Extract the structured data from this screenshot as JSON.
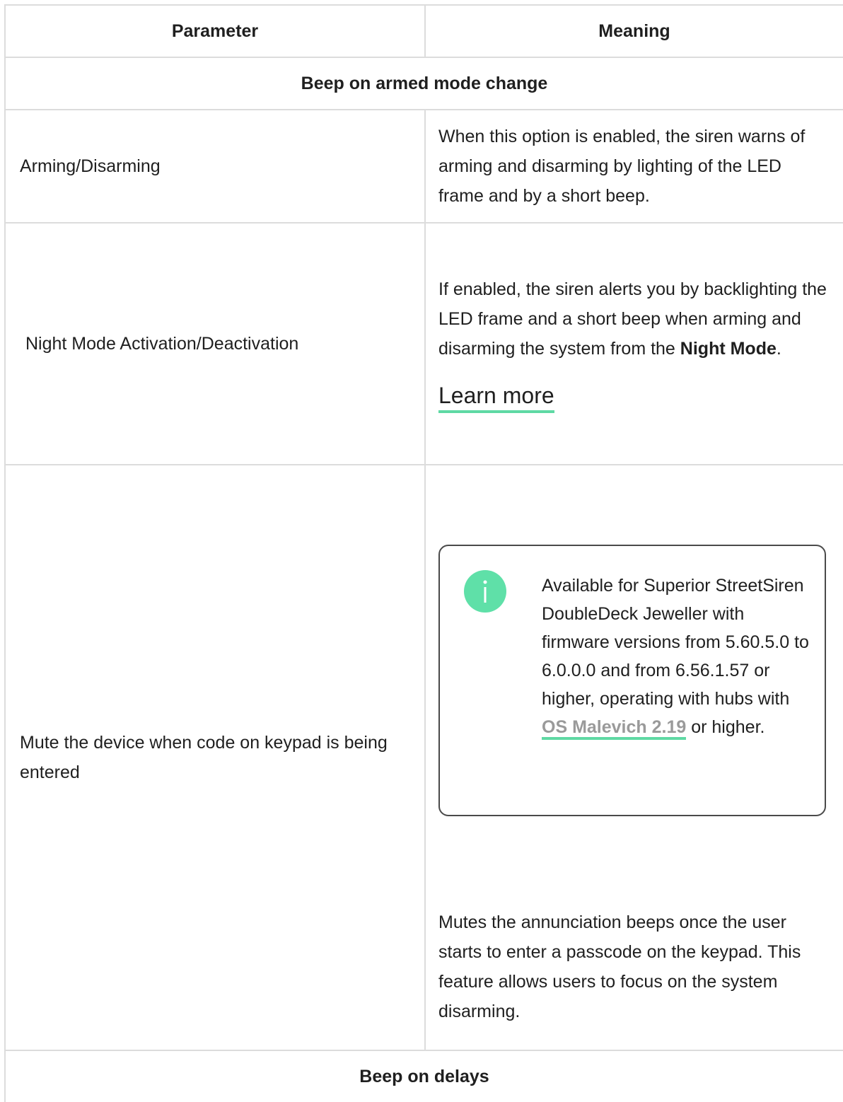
{
  "table": {
    "header": {
      "col1": "Parameter",
      "col2": "Meaning"
    },
    "section1": "Beep on armed mode change",
    "rows": [
      {
        "param": "Arming/Disarming",
        "meaning": "When this option is enabled, the siren warns of arming and disarming by lighting of the LED frame and by a short beep."
      },
      {
        "param": "Night Mode Activation/Deactivation",
        "meaning_part1": "If enabled, the siren alerts you by backlighting the LED frame and a short beep when arming and disarming the system from the ",
        "meaning_strong": "Night Mode",
        "meaning_part2": ".",
        "link": "Learn more"
      },
      {
        "param": "Mute the device when code on keypad is being entered",
        "info": {
          "icon": "info-icon",
          "text_part1": "Available for Superior StreetSiren DoubleDeck Jeweller with firmware versions from 5.60.5.0 to 6.0.0.0 and from 6.56.1.57 or higher, operating with hubs with ",
          "link": "OS Malevich 2.19",
          "text_part2": " or higher."
        },
        "meaning": "Mutes the annunciation beeps once the user starts to enter a passcode on the keypad. This feature allows users to focus on the system disarming."
      }
    ],
    "section2": "Beep on delays"
  },
  "colors": {
    "accent": "#5fd9a4",
    "icon_bg": "#5fe0a8",
    "border": "#dcdcdc",
    "link_gray": "#9a9a9a"
  }
}
